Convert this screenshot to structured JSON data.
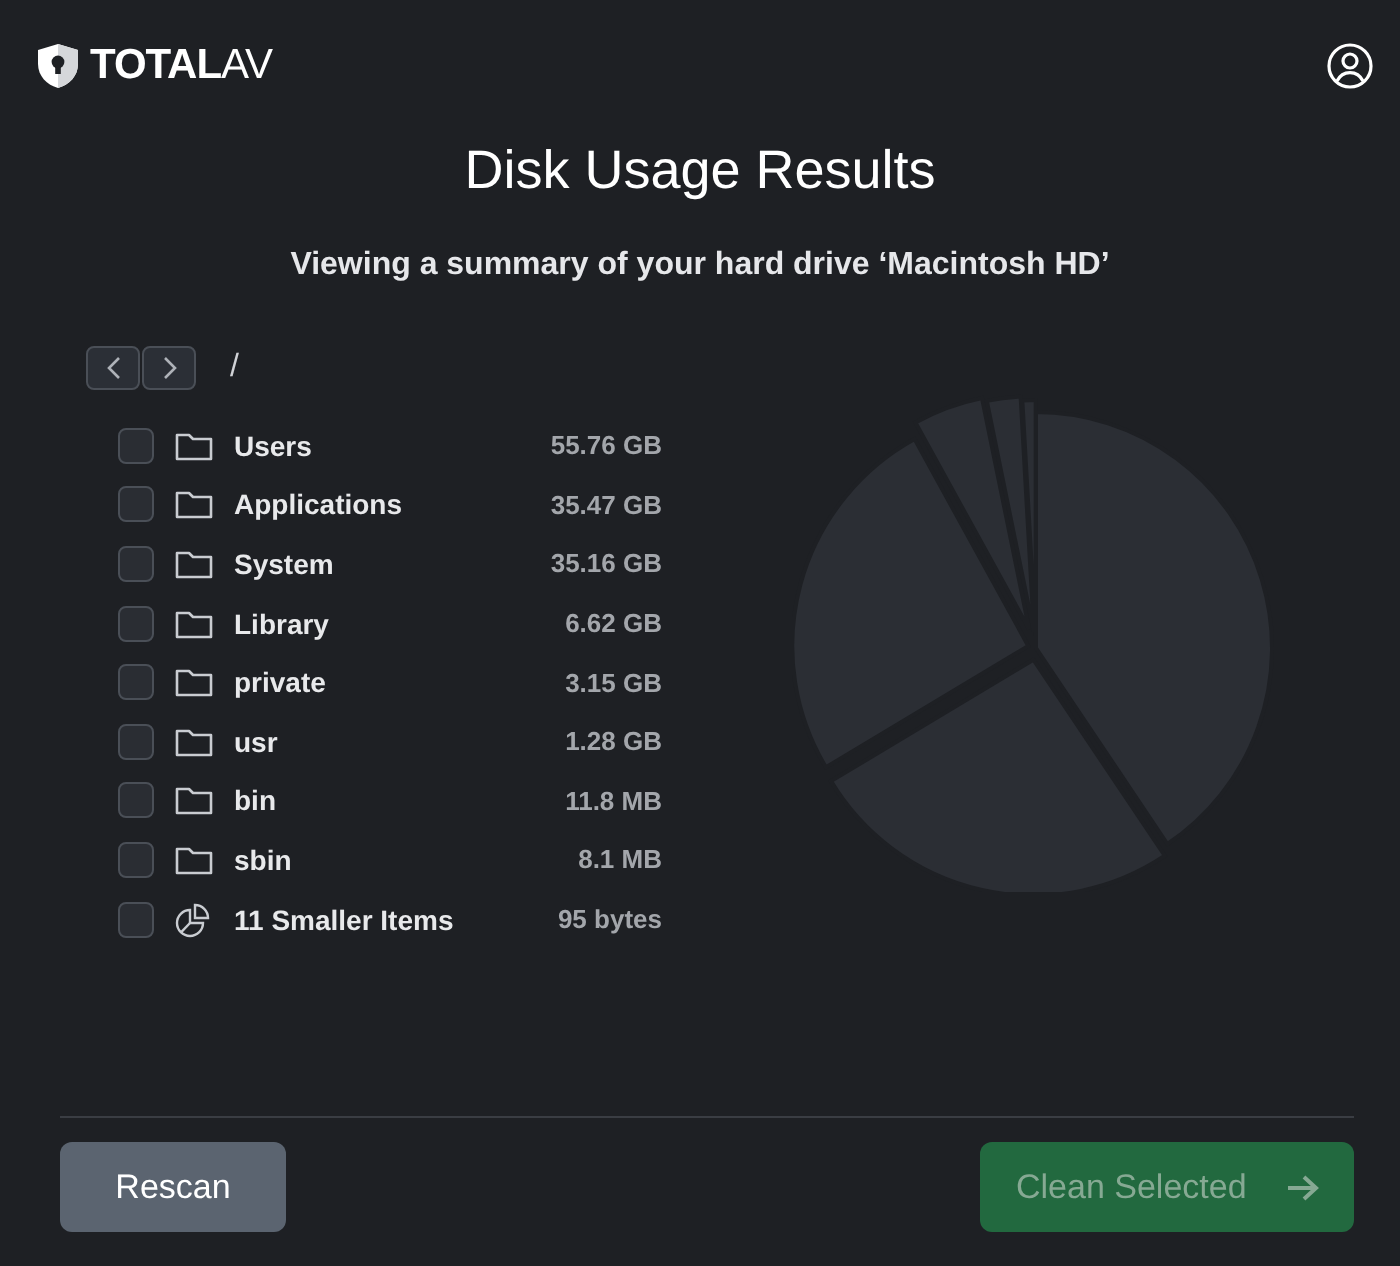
{
  "brand": {
    "bold": "TOTAL",
    "light": "AV"
  },
  "title": "Disk Usage Results",
  "subtitle": "Viewing a summary of your hard drive ‘Macintosh HD’",
  "path": "/",
  "items": [
    {
      "kind": "folder",
      "name": "Users",
      "size": "55.76 GB",
      "checked": false
    },
    {
      "kind": "folder",
      "name": "Applications",
      "size": "35.47 GB",
      "checked": false
    },
    {
      "kind": "folder",
      "name": "System",
      "size": "35.16 GB",
      "checked": false
    },
    {
      "kind": "folder",
      "name": "Library",
      "size": "6.62 GB",
      "checked": false
    },
    {
      "kind": "folder",
      "name": "private",
      "size": "3.15 GB",
      "checked": false
    },
    {
      "kind": "folder",
      "name": "usr",
      "size": "1.28 GB",
      "checked": false
    },
    {
      "kind": "folder",
      "name": "bin",
      "size": "11.8 MB",
      "checked": false
    },
    {
      "kind": "folder",
      "name": "sbin",
      "size": "8.1 MB",
      "checked": false
    },
    {
      "kind": "group",
      "name": "11 Smaller Items",
      "size": "95 bytes",
      "checked": false
    }
  ],
  "buttons": {
    "rescan": {
      "label": "Rescan"
    },
    "clean": {
      "label": "Clean Selected",
      "disabled": true
    }
  }
}
